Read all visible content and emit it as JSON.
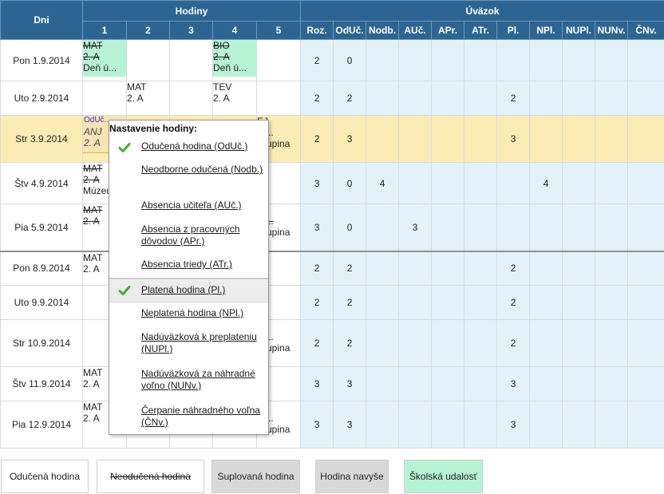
{
  "header": {
    "days": "Dni",
    "hours": "Hodiny",
    "load": "Úväzok",
    "hour_cols": [
      "1",
      "2",
      "3",
      "4",
      "5"
    ],
    "load_cols": [
      "Roz.",
      "OdUč.",
      "Nodb.",
      "AUč.",
      "APr.",
      "ATr.",
      "Pl.",
      "NPl.",
      "NUPl.",
      "NUNv.",
      "ČNv."
    ]
  },
  "rows": [
    {
      "day": "Pon 1.9.2014",
      "lessons": [
        "MAT|2. A|Deň ú...",
        "",
        "",
        "BIO|2. A|Deň ú...",
        ""
      ],
      "load": [
        "2",
        "0",
        "",
        "",
        "",
        "",
        "",
        "",
        "",
        "",
        ""
      ]
    },
    {
      "day": "Uto 2.9.2014",
      "lessons": [
        "",
        "MAT|2. A",
        "",
        "TEV|2. A",
        ""
      ],
      "load": [
        "2",
        "2",
        "",
        "",
        "",
        "",
        "2",
        "",
        "",
        "",
        ""
      ]
    },
    {
      "day": "Str 3.9.2014",
      "lessons": [
        "OdUč...|ANJ|2. A",
        "",
        "",
        "",
        "EJ|A 1.|skupina"
      ],
      "load": [
        "2",
        "3",
        "",
        "",
        "",
        "",
        "3",
        "",
        "",
        "",
        ""
      ]
    },
    {
      "day": "Štv 4.9.2014",
      "lessons": [
        "MAT|2. A|Múzeu",
        "",
        "",
        "",
        ""
      ],
      "load": [
        "3",
        "0",
        "4",
        "",
        "",
        "",
        "",
        "4",
        "",
        "",
        ""
      ]
    },
    {
      "day": "Pia 5.9.2014",
      "lessons": [
        "MAT|2. A",
        "",
        "",
        "",
        "EJ|A 1.|skupina"
      ],
      "load": [
        "3",
        "0",
        "",
        "3",
        "",
        "",
        "",
        "",
        "",
        "",
        ""
      ]
    },
    {
      "day": "Pon 8.9.2014",
      "lessons": [
        "MAT|2. A",
        "",
        "",
        "",
        ""
      ],
      "load": [
        "2",
        "2",
        "",
        "",
        "",
        "",
        "2",
        "",
        "",
        "",
        ""
      ]
    },
    {
      "day": "Uto 9.9.2014",
      "lessons": [
        "",
        "",
        "",
        "",
        ""
      ],
      "load": [
        "2",
        "2",
        "",
        "",
        "",
        "",
        "2",
        "",
        "",
        "",
        ""
      ]
    },
    {
      "day": "Str 10.9.2014",
      "lessons": [
        "",
        "",
        "",
        "",
        "EJ|A 1.|skupina"
      ],
      "load": [
        "2",
        "2",
        "",
        "",
        "",
        "",
        "2",
        "",
        "",
        "",
        ""
      ]
    },
    {
      "day": "Štv 11.9.2014",
      "lessons": [
        "MAT|2. A",
        "",
        "",
        "",
        ""
      ],
      "load": [
        "3",
        "3",
        "",
        "",
        "",
        "",
        "3",
        "",
        "",
        "",
        ""
      ]
    },
    {
      "day": "Pia 12.9.2014",
      "lessons": [
        "MAT|2. A",
        "",
        "",
        "",
        "EJ|A 1.|skupina"
      ],
      "load": [
        "3",
        "3",
        "",
        "",
        "",
        "",
        "3",
        "",
        "",
        "",
        ""
      ]
    }
  ],
  "popup": {
    "title": "Nastavenie hodiny:",
    "items": [
      {
        "label": "Odučená hodina (OdUč.)",
        "checked": true
      },
      {
        "label": "Neodborne odučená (Nodb.)",
        "checked": false
      },
      {
        "label": "Absencia učiteľa (AUč.)",
        "checked": false
      },
      {
        "label": "Absencia z pracovných dôvodov (APr.)",
        "checked": false
      },
      {
        "label": "Absencia triedy (ATr.)",
        "checked": false
      },
      {
        "label": "Platená hodina (Pl.)",
        "checked": true
      },
      {
        "label": "Neplatená hodina (NPl.)",
        "checked": false
      },
      {
        "label": "Nadúväzková k preplateniu (NUPl.)",
        "checked": false
      },
      {
        "label": "Nadúväzková za náhradné voľno (NUNv.)",
        "checked": false
      },
      {
        "label": "Čerpanie náhradného voľna (ČNv.)",
        "checked": false
      }
    ]
  },
  "legend": {
    "taught": "Odučená hodina",
    "not_taught": "Neodučená hodina",
    "substituted": "Suplovaná hodina",
    "extra": "Hodina navyše",
    "school_event": "Školská udalosť"
  },
  "colors": {
    "header_bg": "#2d6592",
    "load_bg": "#e3f2f8",
    "highlight_row": "#fbecb5",
    "school_event": "#b7f2d4",
    "substituted": "#d9d9d9",
    "check": "#4aa83a"
  }
}
